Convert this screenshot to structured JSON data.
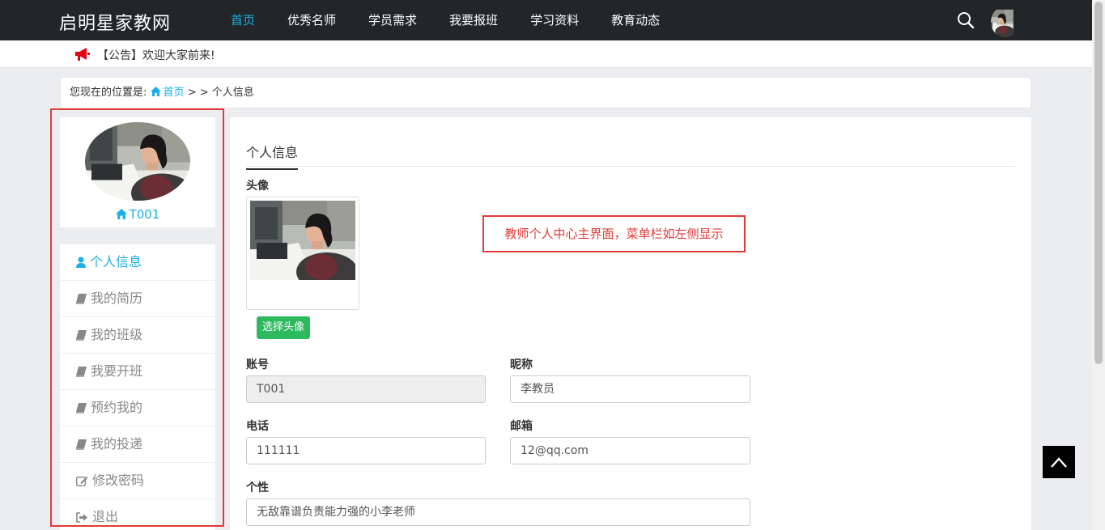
{
  "header": {
    "brand": "启明星家教网",
    "nav": [
      "首页",
      "优秀名师",
      "学员需求",
      "我要报班",
      "学习资料",
      "教育动态"
    ],
    "active_nav": "首页"
  },
  "notice": {
    "text": "【公告】欢迎大家前来!"
  },
  "breadcrumb": {
    "prefix": "您现在的位置是:",
    "home": "首页",
    "sep": " > > ",
    "current": "个人信息"
  },
  "sidebar": {
    "username": "T001",
    "menu": [
      {
        "label": "个人信息",
        "icon": "user-icon",
        "active": true
      },
      {
        "label": "我的简历",
        "icon": "book-icon",
        "active": false
      },
      {
        "label": "我的班级",
        "icon": "book-icon",
        "active": false
      },
      {
        "label": "我要开班",
        "icon": "book-icon",
        "active": false
      },
      {
        "label": "预约我的",
        "icon": "book-icon",
        "active": false
      },
      {
        "label": "我的投递",
        "icon": "book-icon",
        "active": false
      },
      {
        "label": "修改密码",
        "icon": "edit-icon",
        "active": false
      },
      {
        "label": "退出",
        "icon": "sign-out-icon",
        "active": false
      }
    ]
  },
  "main": {
    "tab_title": "个人信息",
    "avatar_label": "头像",
    "choose_avatar_button": "选择头像",
    "annotation": "教师个人中心主界面，菜单栏如左侧显示",
    "fields": {
      "account": {
        "label": "账号",
        "value": "T001"
      },
      "nickname": {
        "label": "昵称",
        "value": "李教员"
      },
      "phone": {
        "label": "电话",
        "value": "111111"
      },
      "email": {
        "label": "邮箱",
        "value": "12@qq.com"
      },
      "personality": {
        "label": "个性",
        "value": "无敌靠谱负责能力强的小李老师"
      }
    }
  },
  "colors": {
    "accent": "#1ab0e6",
    "navbar": "#222628",
    "button_green": "#2dba5f",
    "annotation_red": "#e53935"
  }
}
